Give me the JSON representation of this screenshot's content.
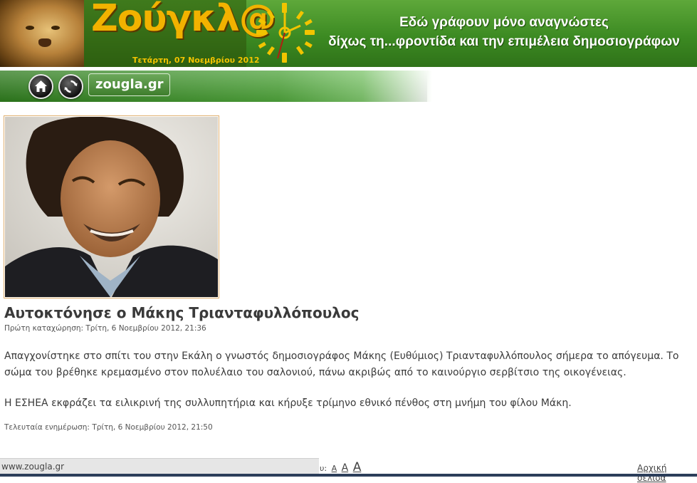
{
  "header": {
    "logo_text": "Ζούγκλ@",
    "date": "Τετάρτη, 07 Νοεμβρίου 2012",
    "slogan_line1": "Εδώ γράφουν μόνο αναγνώστες",
    "slogan_line2": "δίχως τη...φροντίδα και την επιμέλεια δημοσιογράφων"
  },
  "nav": {
    "site_label": "zougla.gr"
  },
  "article": {
    "title": "Αυτοκτόνησε ο Μάκης Τριανταφυλλόπουλος",
    "first_posted_label": "Πρώτη καταχώρηση:",
    "first_posted_value": "Τρίτη, 6 Νοεμβρίου 2012, 21:36",
    "paragraph1": "Απαγχονίστηκε στο σπίτι του στην Εκάλη ο γνωστός δημοσιογράφος Μάκης (Ευθύμιος) Τριανταφυλλόπουλος σήμερα το απόγευμα. Το σώμα του βρέθηκε κρεμασμένο στον πολυέλαιο του σαλονιού, πάνω ακριβώς από το καινούργιο σερβίτσιο της οικογένειας.",
    "paragraph2": "Η ΕΣΗΕΑ εκφράζει τα ειλικρινή της συλλυπητήρια και κήρυξε τρίμηνο εθνικό πένθος στη μνήμη του φίλου Μάκη.",
    "last_updated_label": "Τελευταία ενημέρωση:",
    "last_updated_value": "Τρίτη, 6 Νοεμβρίου 2012, 21:50"
  },
  "footer": {
    "status_url": "www.zougla.gr",
    "fontsize_prefix": "υ:",
    "font_small": "A",
    "font_medium": "A",
    "font_large": "A",
    "home_link": "Αρχική σελίδα"
  },
  "colors": {
    "header_green": "#3c8a22",
    "logo_yellow": "#f2b200",
    "photo_border": "#e0b070"
  }
}
